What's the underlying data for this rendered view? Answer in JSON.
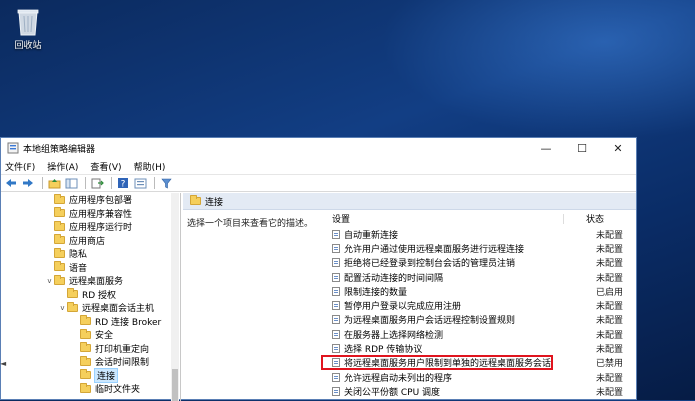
{
  "desktop": {
    "recycle_bin_label": "回收站",
    "recycle_icon": "recycle-bin-icon"
  },
  "window": {
    "title": "本地组策略编辑器",
    "controls": {
      "minimize": "—",
      "maximize": "☐",
      "close": "✕"
    },
    "menu": [
      "文件(F)",
      "操作(A)",
      "查看(V)",
      "帮助(H)"
    ]
  },
  "tree": [
    {
      "label": "应用程序包部署",
      "level": 5,
      "expander": ""
    },
    {
      "label": "应用程序兼容性",
      "level": 5,
      "expander": ""
    },
    {
      "label": "应用程序运行时",
      "level": 5,
      "expander": ""
    },
    {
      "label": "应用商店",
      "level": 5,
      "expander": ""
    },
    {
      "label": "隐私",
      "level": 5,
      "expander": ""
    },
    {
      "label": "语音",
      "level": 5,
      "expander": ""
    },
    {
      "label": "远程桌面服务",
      "level": 5,
      "expander": "v"
    },
    {
      "label": "RD 授权",
      "level": 6,
      "expander": ""
    },
    {
      "label": "远程桌面会话主机",
      "level": 6,
      "expander": "v"
    },
    {
      "label": "RD 连接 Broker",
      "level": 7,
      "expander": ""
    },
    {
      "label": "安全",
      "level": 7,
      "expander": ""
    },
    {
      "label": "打印机重定向",
      "level": 7,
      "expander": ""
    },
    {
      "label": "会话时间限制",
      "level": 7,
      "expander": ""
    },
    {
      "label": "连接",
      "level": 7,
      "expander": "",
      "selected": true
    },
    {
      "label": "临时文件夹",
      "level": 7,
      "expander": ""
    }
  ],
  "right": {
    "section_title": "连接",
    "description": "选择一个项目来查看它的描述。",
    "col_setting": "设置",
    "col_state": "状态",
    "policies": [
      {
        "name": "自动重新连接",
        "state": "未配置"
      },
      {
        "name": "允许用户通过使用远程桌面服务进行远程连接",
        "state": "未配置"
      },
      {
        "name": "拒绝将已经登录到控制台会话的管理员注销",
        "state": "未配置"
      },
      {
        "name": "配置活动连接的时间间隔",
        "state": "未配置"
      },
      {
        "name": "限制连接的数量",
        "state": "已启用"
      },
      {
        "name": "暂停用户登录以完成应用注册",
        "state": "未配置"
      },
      {
        "name": "为远程桌面服务用户会话远程控制设置规则",
        "state": "未配置"
      },
      {
        "name": "在服务器上选择网络检测",
        "state": "未配置"
      },
      {
        "name": "选择 RDP 传输协议",
        "state": "未配置"
      },
      {
        "name": "将远程桌面服务用户限制到单独的远程桌面服务会话",
        "state": "已禁用"
      },
      {
        "name": "允许远程启动未列出的程序",
        "state": "未配置"
      },
      {
        "name": "关闭公平份额 CPU 调度",
        "state": "未配置"
      }
    ]
  }
}
